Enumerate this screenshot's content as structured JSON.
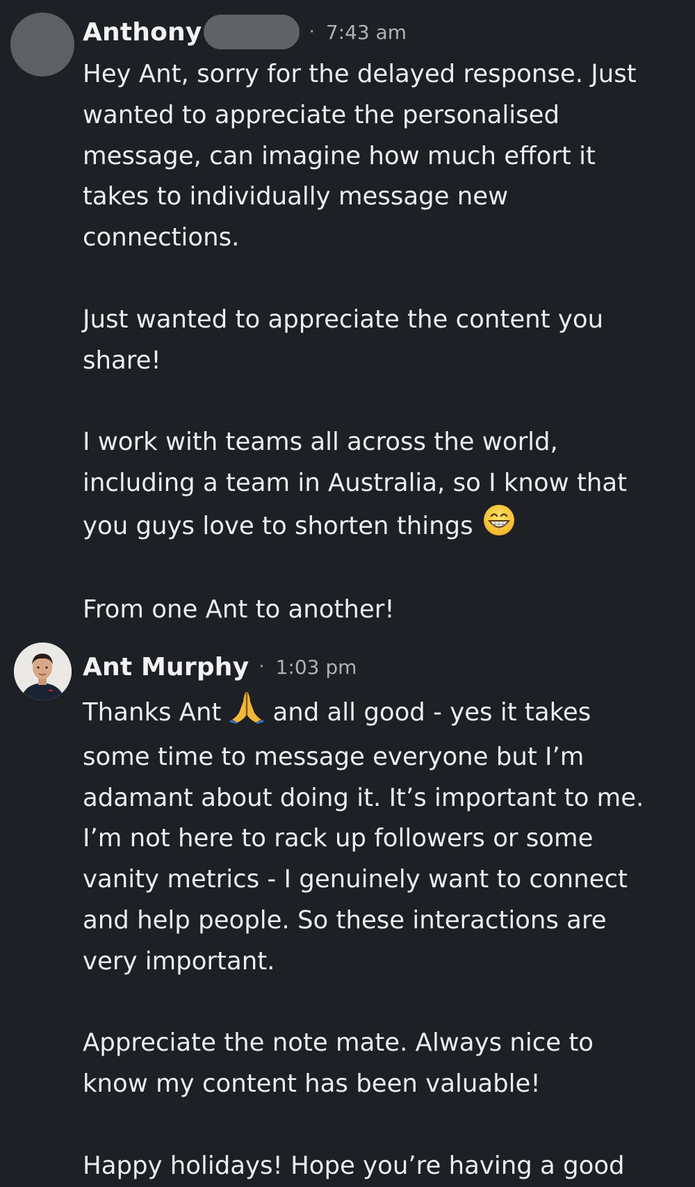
{
  "messages": [
    {
      "sender": "Anthony",
      "time": "7:43 am",
      "separator": "·",
      "avatar": "placeholder-avatar",
      "sender_redacted": true,
      "lines": {
        "l1": "Hey Ant, sorry for the delayed response. Just",
        "l2": "wanted to appreciate the personalised",
        "l3": "message, can imagine how much effort it",
        "l4": "takes to individually message new",
        "l5": "connections.",
        "l6": "Just wanted to appreciate the content you",
        "l7": "share!",
        "l8": "I work with teams all across the world,",
        "l9": "including a team in Australia, so I know that",
        "l10": "you guys love to shorten things",
        "l11": "From one Ant to another!"
      },
      "emoji": "grinning-face-emoji"
    },
    {
      "sender": "Ant Murphy",
      "time": "1:03 pm",
      "separator": "·",
      "avatar": "profile-photo",
      "lines": {
        "l1a": "Thanks Ant",
        "l1b": "and all good - yes it takes",
        "l2": "some time to message everyone but I’m",
        "l3": "adamant about doing it. It’s important to me.",
        "l4": "I’m not here to rack up followers or some",
        "l5": "vanity metrics - I genuinely want to connect",
        "l6": "and help people. So these interactions are",
        "l7": "very important.",
        "l8": "Appreciate the note mate. Always nice to",
        "l9": "know my content has been valuable!",
        "l10": "Happy holidays! Hope you’re having a good"
      },
      "emoji": "folded-hands-emoji"
    }
  ],
  "colors": {
    "background": "#1d2024",
    "text": "#eeeeee",
    "timestamp": "#b2b2b2",
    "redaction": "#606264",
    "avatar_placeholder": "#5f6062"
  }
}
